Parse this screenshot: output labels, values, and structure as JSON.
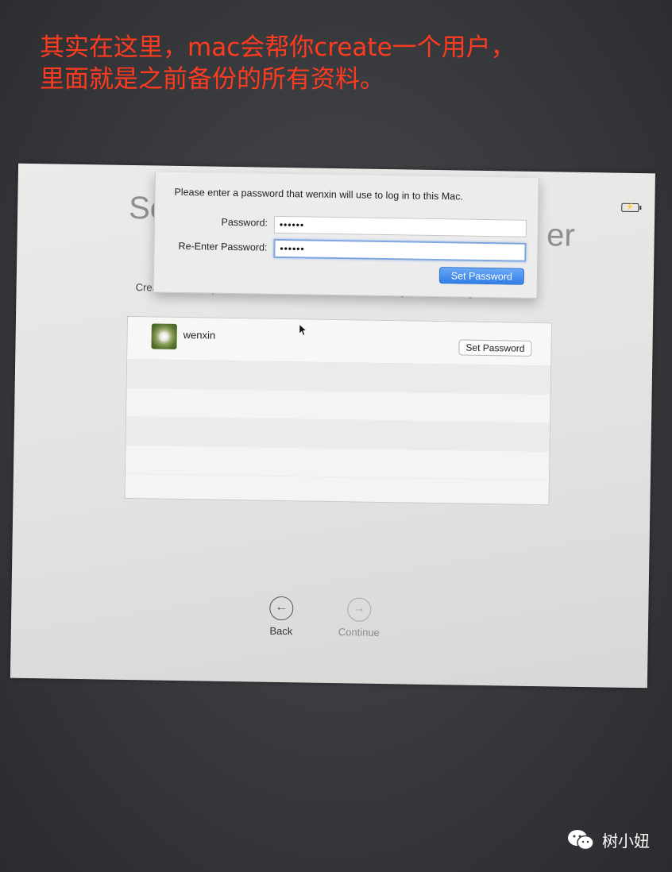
{
  "annotation": {
    "line1": "其实在这里，mac会帮你create一个用户，",
    "line2": "里面就是之前备份的所有资料。",
    "color": "#ff3b1f"
  },
  "window": {
    "title_left_fragment": "Se",
    "title_right_fragment": "er",
    "subtitle": "Create a secure password for each Administrator account you want to migrate:",
    "battery_icon": "battery-charging-icon"
  },
  "sheet": {
    "prompt": "Please enter a password that wenxin will use to log in to this Mac.",
    "password_label": "Password:",
    "password_value": "••••••",
    "reenter_label": "Re-Enter Password:",
    "reenter_value": "••••••",
    "set_password_button": "Set Password"
  },
  "users": [
    {
      "name": "wenxin",
      "button": "Set Password"
    }
  ],
  "nav": {
    "back_label": "Back",
    "continue_label": "Continue",
    "back_icon": "←",
    "continue_icon": "→"
  },
  "watermark": {
    "text": "树小妞",
    "icon": "wechat-icon"
  }
}
